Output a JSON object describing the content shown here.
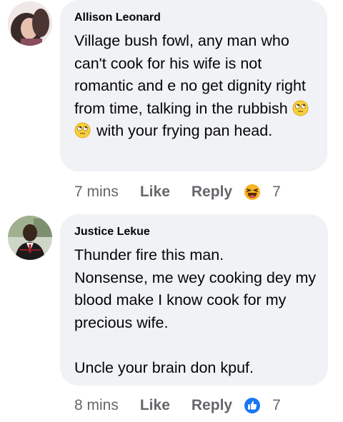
{
  "comments": [
    {
      "author": "Allison Leonard",
      "text_before_emoji": "Village bush fowl, any man who can't cook for his wife is not romantic and e no get dignity right from time, talking in the rubbish ",
      "emoji_names": [
        "face-with-rolling-eyes-icon",
        "face-with-rolling-eyes-icon"
      ],
      "text_after_emoji": " with your frying pan head.",
      "time": "7 mins",
      "like_label": "Like",
      "reply_label": "Reply",
      "reaction_icon": "laughing-face-icon",
      "reaction_count": "7"
    },
    {
      "author": "Justice Lekue",
      "text": "Thunder fire this man.\nNonsense, me wey cooking dey my blood make I know cook for my precious wife.\n\nUncle your brain don kpuf.",
      "time": "8 mins",
      "like_label": "Like",
      "reply_label": "Reply",
      "reaction_icon": "thumbs-up-icon",
      "reaction_count": "7"
    }
  ],
  "colors": {
    "bubble_bg": "#f0f2f5",
    "text": "#050505",
    "meta_text": "#65676b",
    "like_blue": "#1877f2",
    "haha_yellow": "#f7b125"
  }
}
